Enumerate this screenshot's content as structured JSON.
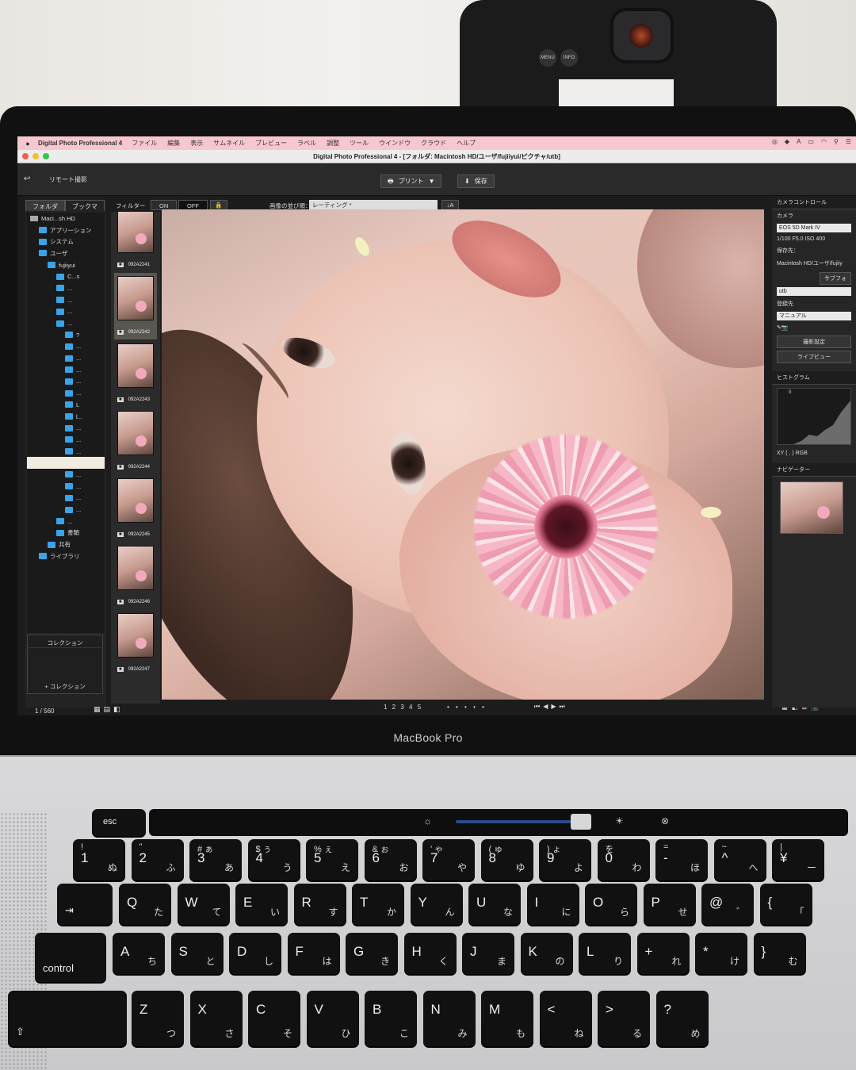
{
  "menubar": {
    "app_name": "Digital Photo Professional 4",
    "items": [
      "ファイル",
      "編集",
      "表示",
      "サムネイル",
      "プレビュー",
      "ラベル",
      "調整",
      "ツール",
      "ウインドウ",
      "クラウド",
      "ヘルプ"
    ]
  },
  "window": {
    "title": "Digital Photo Professional 4 - [フォルダ: Macintosh HD/ユーザ/fujiiyui/ピクチャ/utb]"
  },
  "toolbar": {
    "remote_label": "リモート撮影",
    "print_label": "プリント",
    "save_label": "保存"
  },
  "folder_panel": {
    "tabs": [
      "フォルダ",
      "ブックマ"
    ],
    "tree": [
      {
        "label": "Maci...sh HD",
        "indent": 0,
        "kind": "disk"
      },
      {
        "label": "アプリ一ション",
        "indent": 1,
        "kind": "folder"
      },
      {
        "label": "システム",
        "indent": 1,
        "kind": "folder"
      },
      {
        "label": "ユーザ",
        "indent": 1,
        "kind": "folder"
      },
      {
        "label": "fujiiyui",
        "indent": 2,
        "kind": "folder"
      },
      {
        "label": "C...s",
        "indent": 3,
        "kind": "folder"
      },
      {
        "label": "...",
        "indent": 3,
        "kind": "folder"
      },
      {
        "label": "...",
        "indent": 3,
        "kind": "folder"
      },
      {
        "label": "...",
        "indent": 3,
        "kind": "folder"
      },
      {
        "label": "...",
        "indent": 3,
        "kind": "folder"
      },
      {
        "label": "?",
        "indent": 4,
        "kind": "folder"
      },
      {
        "label": "...",
        "indent": 4,
        "kind": "folder"
      },
      {
        "label": "...",
        "indent": 4,
        "kind": "folder"
      },
      {
        "label": "...",
        "indent": 4,
        "kind": "folder"
      },
      {
        "label": "...",
        "indent": 4,
        "kind": "folder"
      },
      {
        "label": "...",
        "indent": 4,
        "kind": "folder"
      },
      {
        "label": "L",
        "indent": 4,
        "kind": "folder"
      },
      {
        "label": "l...",
        "indent": 4,
        "kind": "folder"
      },
      {
        "label": "...",
        "indent": 4,
        "kind": "folder"
      },
      {
        "label": "...",
        "indent": 4,
        "kind": "folder"
      },
      {
        "label": "...",
        "indent": 4,
        "kind": "folder"
      },
      {
        "label": "",
        "indent": 4,
        "kind": "selected"
      },
      {
        "label": "...",
        "indent": 4,
        "kind": "folder"
      },
      {
        "label": "...",
        "indent": 4,
        "kind": "folder"
      },
      {
        "label": "...",
        "indent": 4,
        "kind": "folder"
      },
      {
        "label": "...",
        "indent": 4,
        "kind": "folder"
      },
      {
        "label": "...",
        "indent": 3,
        "kind": "folder"
      },
      {
        "label": "書類",
        "indent": 3,
        "kind": "folder"
      },
      {
        "label": "共有",
        "indent": 2,
        "kind": "folder"
      },
      {
        "label": "ライブラリ",
        "indent": 1,
        "kind": "folder"
      }
    ],
    "collection_header": "コレクション",
    "collection_add": "+ コレクション"
  },
  "filter": {
    "label": "フィルター",
    "on_label": "ON",
    "off_label": "OFF",
    "sort_label": "画像の並び順：",
    "sort_value": "レーティング *"
  },
  "thumbnails": [
    {
      "name": "092A2241"
    },
    {
      "name": "092A2242"
    },
    {
      "name": "092A2243"
    },
    {
      "name": "092A2244"
    },
    {
      "name": "092A2245"
    },
    {
      "name": "092A2246"
    },
    {
      "name": "092A2247"
    }
  ],
  "viewer": {
    "image_count": "1 / 560",
    "stars": "1 2 3 4 5"
  },
  "camera_control": {
    "header": "カメラコントロール",
    "camera_label": "カメラ",
    "camera_model": "EOS 5D Mark IV",
    "exposure": "1/100  F5.0  ISO 400",
    "save_to_label": "保存先：",
    "save_path": "Macintosh HD/ユーザ/fujiiy",
    "subfolder_button": "サブフォ",
    "folder_name": "utb",
    "register_label": "登録先",
    "register_value": "マニュアル",
    "shooting_settings_button": "撮影設定",
    "live_view_button": "ライブビュー",
    "histogram_header": "ヒストグラム",
    "histogram_tick": "0",
    "xy_label": "XY (        ,        ) RGB",
    "navigator_header": "ナビゲーター"
  },
  "laptop": {
    "brand": "MacBook Pro"
  },
  "keyboard": {
    "esc": "esc",
    "row1": [
      {
        "top": "!",
        "main": "1",
        "kana": "ぬ"
      },
      {
        "top": "\"",
        "main": "2",
        "kana": "ふ"
      },
      {
        "top": "#  ぁ",
        "main": "3",
        "kana": "あ"
      },
      {
        "top": "$  ぅ",
        "main": "4",
        "kana": "う"
      },
      {
        "top": "%  ぇ",
        "main": "5",
        "kana": "え"
      },
      {
        "top": "&  ぉ",
        "main": "6",
        "kana": "お"
      },
      {
        "top": "'  ゃ",
        "main": "7",
        "kana": "や"
      },
      {
        "top": "(  ゅ",
        "main": "8",
        "kana": "ゆ"
      },
      {
        "top": ")  ょ",
        "main": "9",
        "kana": "よ"
      },
      {
        "top": "を",
        "main": "0",
        "kana": "わ"
      },
      {
        "top": "=",
        "main": "-",
        "kana": "ほ"
      },
      {
        "top": "~",
        "main": "^",
        "kana": "へ"
      },
      {
        "top": "|",
        "main": "¥",
        "kana": "ー"
      }
    ],
    "row2": [
      {
        "main": "Q",
        "kana": "た"
      },
      {
        "main": "W",
        "kana": "て"
      },
      {
        "main": "E",
        "kana": "い"
      },
      {
        "main": "R",
        "kana": "す"
      },
      {
        "main": "T",
        "kana": "か"
      },
      {
        "main": "Y",
        "kana": "ん"
      },
      {
        "main": "U",
        "kana": "な"
      },
      {
        "main": "I",
        "kana": "に"
      },
      {
        "main": "O",
        "kana": "ら"
      },
      {
        "main": "P",
        "kana": "せ"
      },
      {
        "main": "@",
        "kana": "゛"
      },
      {
        "main": "{",
        "kana": "「"
      }
    ],
    "row3": [
      {
        "main": "A",
        "kana": "ち"
      },
      {
        "main": "S",
        "kana": "と"
      },
      {
        "main": "D",
        "kana": "し"
      },
      {
        "main": "F",
        "kana": "は"
      },
      {
        "main": "G",
        "kana": "き"
      },
      {
        "main": "H",
        "kana": "く"
      },
      {
        "main": "J",
        "kana": "ま"
      },
      {
        "main": "K",
        "kana": "の"
      },
      {
        "main": "L",
        "kana": "り"
      },
      {
        "main": "+",
        "kana": "れ"
      },
      {
        "main": "*",
        "kana": "け"
      },
      {
        "main": "}",
        "kana": "む"
      }
    ],
    "row4": [
      {
        "main": "Z",
        "kana": "つ"
      },
      {
        "main": "X",
        "kana": "さ"
      },
      {
        "main": "C",
        "kana": "そ"
      },
      {
        "main": "V",
        "kana": "ひ"
      },
      {
        "main": "B",
        "kana": "こ"
      },
      {
        "main": "N",
        "kana": "み"
      },
      {
        "main": "M",
        "kana": "も"
      },
      {
        "main": "<",
        "kana": "ね"
      },
      {
        "main": ">",
        "kana": "る"
      },
      {
        "main": "?",
        "kana": "め"
      }
    ],
    "tab": "⇥",
    "control": "control",
    "shift": "⇧"
  }
}
